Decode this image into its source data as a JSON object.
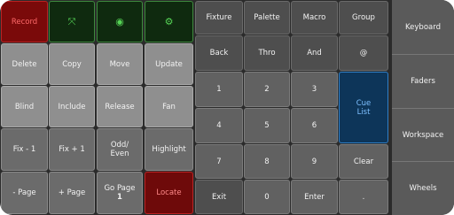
{
  "top_row": {
    "record": "Record",
    "shrink_icon": "⤧",
    "user_icon": "◉",
    "gear_icon": "⚙"
  },
  "row2": [
    "Delete",
    "Copy",
    "Move",
    "Update"
  ],
  "row3": [
    "Blind",
    "Include",
    "Release",
    "Fan"
  ],
  "row4": [
    "Fix - 1",
    "Fix + 1",
    "Odd/ Even",
    "Highlight"
  ],
  "row5": {
    "prev_page": "- Page",
    "next_page": "+ Page",
    "goto_page": "Go Page",
    "goto_page_num": "1",
    "locate": "Locate"
  },
  "command": [
    "Fixture",
    "Palette",
    "Macro",
    "Group"
  ],
  "ops": [
    "Back",
    "Thro",
    "And",
    "@"
  ],
  "numpad": [
    "1",
    "2",
    "3",
    "4",
    "5",
    "6",
    "7",
    "8",
    "9"
  ],
  "cue_list": {
    "line1": "Cue",
    "line2": "List"
  },
  "clear": "Clear",
  "bottom": [
    "Exit",
    "0",
    "Enter",
    "."
  ],
  "side_tabs": [
    "Keyboard",
    "Faders",
    "Workspace",
    "Wheels"
  ],
  "colors": {
    "record": "#7a0a0a",
    "cue_list": "#0d3559",
    "accent_green": "#55d255"
  }
}
